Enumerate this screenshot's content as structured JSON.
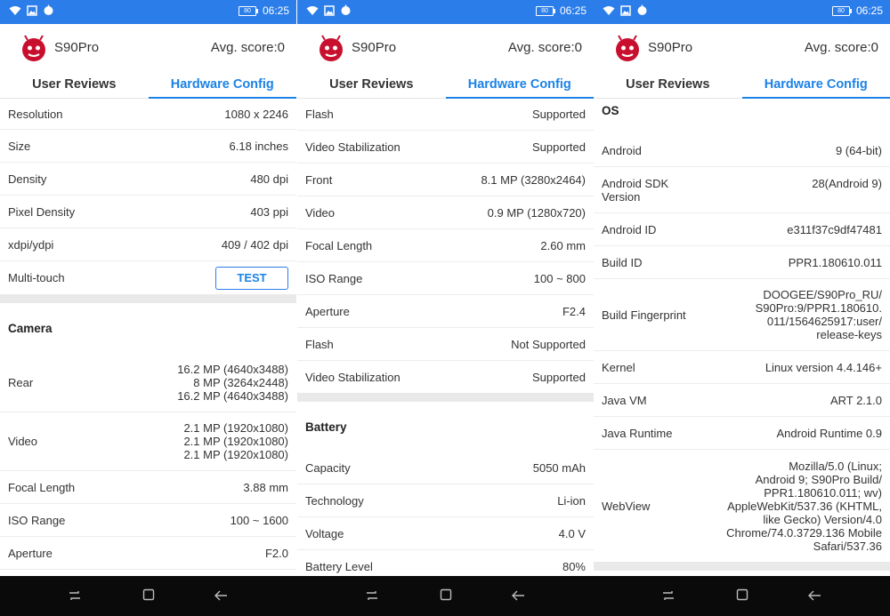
{
  "status_bar": {
    "time": "06:25",
    "battery": "80"
  },
  "app": {
    "device_name": "S90Pro",
    "avg_score": "Avg. score:0"
  },
  "tabs": {
    "reviews": "User Reviews",
    "config": "Hardware Config"
  },
  "colors": {
    "status_bar": "#2b7de9",
    "accent": "#1b82e6",
    "section_gap": "#e9e9e9"
  },
  "screen1": {
    "rows": [
      {
        "label": "Resolution",
        "value": "1080 x 2246"
      },
      {
        "label": "Size",
        "value": "6.18 inches"
      },
      {
        "label": "Density",
        "value": "480 dpi"
      },
      {
        "label": "Pixel Density",
        "value": "403 ppi"
      },
      {
        "label": "xdpi/ydpi",
        "value": "409 / 402 dpi"
      },
      {
        "label": "Multi-touch",
        "button": "TEST"
      }
    ],
    "camera_title": "Camera",
    "camera_rows": [
      {
        "label": "Rear",
        "value": "16.2 MP (4640x3488)\n8 MP (3264x2448)\n16.2 MP (4640x3488)"
      },
      {
        "label": "Video",
        "value": "2.1 MP (1920x1080)\n2.1 MP (1920x1080)\n2.1 MP (1920x1080)"
      },
      {
        "label": "Focal Length",
        "value": "3.88 mm"
      },
      {
        "label": "ISO Range",
        "value": "100 ~ 1600"
      },
      {
        "label": "Aperture",
        "value": "F2.0"
      }
    ]
  },
  "screen2": {
    "rows": [
      {
        "label": "Flash",
        "value": "Supported"
      },
      {
        "label": "Video Stabilization",
        "value": "Supported"
      },
      {
        "label": "Front",
        "value": "8.1 MP (3280x2464)"
      },
      {
        "label": "Video",
        "value": "0.9 MP (1280x720)"
      },
      {
        "label": "Focal Length",
        "value": "2.60 mm"
      },
      {
        "label": "ISO Range",
        "value": "100 ~ 800"
      },
      {
        "label": "Aperture",
        "value": "F2.4"
      },
      {
        "label": "Flash",
        "value": "Not Supported"
      },
      {
        "label": "Video Stabilization",
        "value": "Supported"
      }
    ],
    "battery_title": "Battery",
    "battery_rows": [
      {
        "label": "Capacity",
        "value": "5050 mAh"
      },
      {
        "label": "Technology",
        "value": "Li-ion"
      },
      {
        "label": "Voltage",
        "value": "4.0 V"
      },
      {
        "label": "Battery Level",
        "value": "80%"
      }
    ]
  },
  "screen3": {
    "os_title": "OS",
    "rows": [
      {
        "label": "Android",
        "value": "9 (64-bit)"
      },
      {
        "label": "Android SDK\nVersion",
        "value": "28(Android 9)"
      },
      {
        "label": "Android ID",
        "value": "e311f37c9df47481"
      },
      {
        "label": "Build ID",
        "value": "PPR1.180610.011"
      },
      {
        "label": "Build Fingerprint",
        "value": "DOOGEE/S90Pro_RU/\nS90Pro:9/PPR1.180610.\n011/1564625917:user/\nrelease-keys"
      },
      {
        "label": "Kernel",
        "value": "Linux version 4.4.146+"
      },
      {
        "label": "Java VM",
        "value": "ART 2.1.0"
      },
      {
        "label": "Java Runtime",
        "value": "Android Runtime 0.9"
      },
      {
        "label": "WebView",
        "value": "Mozilla/5.0 (Linux;\nAndroid 9; S90Pro Build/\nPPR1.180610.011; wv)\nAppleWebKit/537.36 (KHTML,\nlike Gecko) Version/4.0\nChrome/74.0.3729.136 Mobile\nSafari/537.36"
      }
    ]
  }
}
